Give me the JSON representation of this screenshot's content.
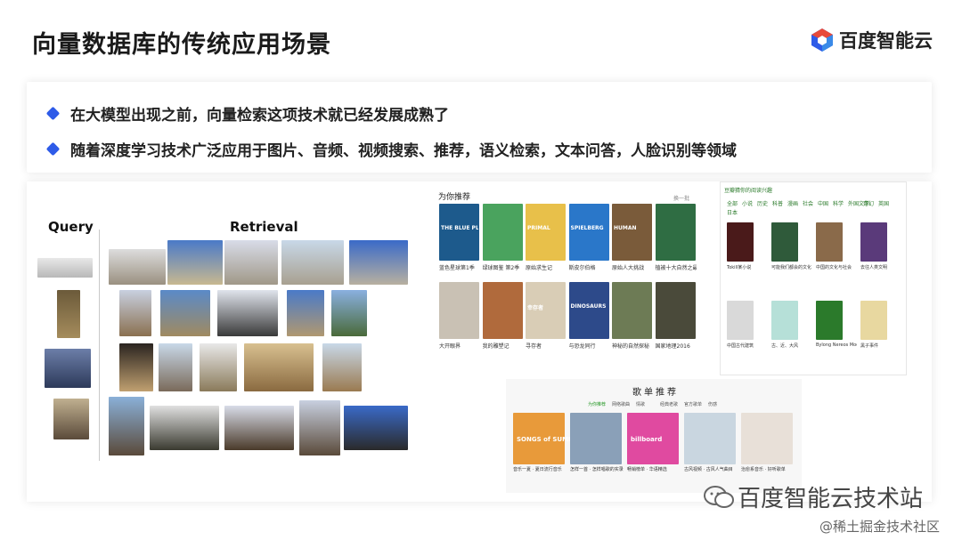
{
  "slide": {
    "title": "向量数据库的传统应用场景",
    "brand": "百度智能云",
    "bullets": [
      "在大模型出现之前，向量检索这项技术就已经发展成熟了",
      "随着深度学习技术广泛应用于图片、音频、视频搜索、推荐，语义检索，文本问答，人脸识别等领域"
    ]
  },
  "retrieval_demo": {
    "query_label": "Query",
    "retrieval_label": "Retrieval"
  },
  "video_rec": {
    "title": "为你推荐",
    "refresh": "换一批",
    "items": [
      {
        "title": "蓝色星球第1季",
        "sub": "BBC",
        "color": "#1d5a8c",
        "text": "THE BLUE PLANET"
      },
      {
        "title": "绿球图鉴 第2季",
        "sub": "BBC",
        "color": "#4aa35e",
        "text": ""
      },
      {
        "title": "原始求生记",
        "sub": "",
        "color": "#e8c04a",
        "text": "PRIMAL"
      },
      {
        "title": "斯皮尔伯格",
        "sub": "",
        "color": "#2a77c9",
        "text": "SPIELBERG"
      },
      {
        "title": "原始人大挑战",
        "sub": "",
        "color": "#7a5b3a",
        "text": "HUMAN"
      },
      {
        "title": "植被十大自然之最",
        "sub": "",
        "color": "#2f6d43",
        "text": ""
      },
      {
        "title": "大开眼界",
        "sub": "",
        "color": "#c9c1b4",
        "text": ""
      },
      {
        "title": "我的雕塑记",
        "sub": "",
        "color": "#b06a3c",
        "text": ""
      },
      {
        "title": "寻存者",
        "sub": "",
        "color": "#d9cdb6",
        "text": "幸存者"
      },
      {
        "title": "与恐龙同行",
        "sub": "",
        "color": "#2d4a8a",
        "text": "DINOSAURS"
      },
      {
        "title": "神秘的自然探秘",
        "sub": "",
        "color": "#6d7b55",
        "text": ""
      },
      {
        "title": "国家地理2016",
        "sub": "",
        "color": "#4a4a3a",
        "text": ""
      }
    ]
  },
  "book_rec": {
    "title": "豆瓣猜你的阅读兴趣",
    "tabs": [
      "全部",
      "小说",
      "历史",
      "科普",
      "漫画",
      "社会",
      "中国",
      "科学",
      "外国文学",
      "奇幻",
      "英国",
      "日本"
    ],
    "items": [
      {
        "title": "Tokill某小说",
        "color": "#4a1a1a"
      },
      {
        "title": "可能我们都会的文化",
        "color": "#2f5a3a"
      },
      {
        "title": "中国的文化与社会",
        "color": "#8a6a4a"
      },
      {
        "title": "去往人类文明",
        "color": "#5a3a7a"
      },
      {
        "title": "中国古代建筑",
        "color": "#d9d9d9"
      },
      {
        "title": "古、近、大风",
        "color": "#b6e0d8"
      },
      {
        "title": "Bylong Nereos Models",
        "color": "#2b7a2b"
      },
      {
        "title": "黑子事件",
        "color": "#e8d8a0"
      }
    ]
  },
  "songs": {
    "title": "歌单推荐",
    "tabs": [
      "为你推荐",
      "网络歌曲",
      "情歌",
      "经典老歌",
      "官方歌单",
      "伤感"
    ],
    "items": [
      {
        "title": "音乐一夏 · 夏日流行音乐",
        "color": "#e89a3a",
        "text": "SONGS of SUMMER"
      },
      {
        "title": "怎样一首 · 怎样唱歌的实录",
        "color": "#8aa0b8",
        "text": ""
      },
      {
        "title": "畅销榜单 · 华语精选",
        "color": "#e04aa0",
        "text": "billboard"
      },
      {
        "title": "古风视频 · 古风人气曲目",
        "color": "#c9d6e0",
        "text": ""
      },
      {
        "title": "治愈系音乐 · 好听歌单",
        "color": "#e8e0d8",
        "text": ""
      }
    ]
  },
  "watermarks": {
    "main": "百度智能云技术站",
    "secondary": "@稀土掘金技术社区"
  },
  "colors": {
    "accent": "#2e5be8"
  }
}
